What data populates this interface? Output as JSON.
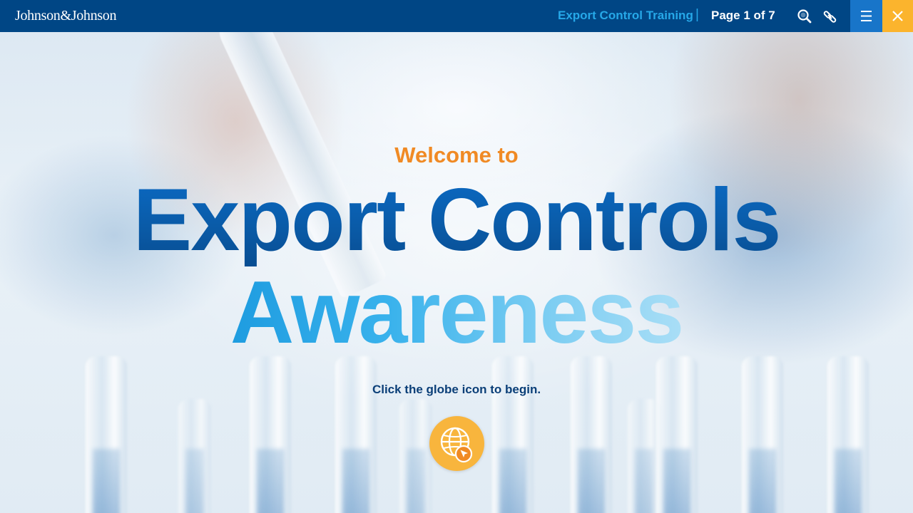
{
  "header": {
    "logo": "Johnson&Johnson",
    "course_title": "Export Control Training",
    "separator": "|",
    "page_indicator": "Page 1 of 7",
    "icons": [
      "search-icon",
      "link-icon",
      "menu-icon",
      "close-icon"
    ]
  },
  "main": {
    "welcome": "Welcome to",
    "headline_line1": "Export Controls",
    "headline_line2": "Awareness",
    "instruction": "Click the globe icon to begin.",
    "start_icon": "globe-cursor-icon"
  },
  "colors": {
    "topbar": "#004685",
    "accent_blue": "#26a8e8",
    "menu_button": "#1875c9",
    "close_button": "#fbb42d",
    "welcome_orange": "#f08a24",
    "globe_button": "#f8b53d"
  }
}
